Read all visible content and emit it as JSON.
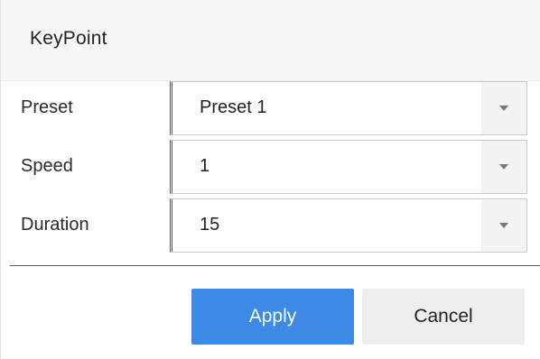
{
  "dialog": {
    "title": "KeyPoint"
  },
  "fields": [
    {
      "label": "Preset",
      "value": "Preset 1",
      "icon": "chevron-down-icon"
    },
    {
      "label": "Speed",
      "value": "1",
      "icon": "chevron-down-icon"
    },
    {
      "label": "Duration",
      "value": "15",
      "icon": "chevron-down-icon"
    }
  ],
  "buttons": {
    "apply_label": "Apply",
    "cancel_label": "Cancel"
  },
  "colors": {
    "primary": "#3d8ae6",
    "secondary": "#eeeeee",
    "header_bg": "#f7f7f7"
  }
}
